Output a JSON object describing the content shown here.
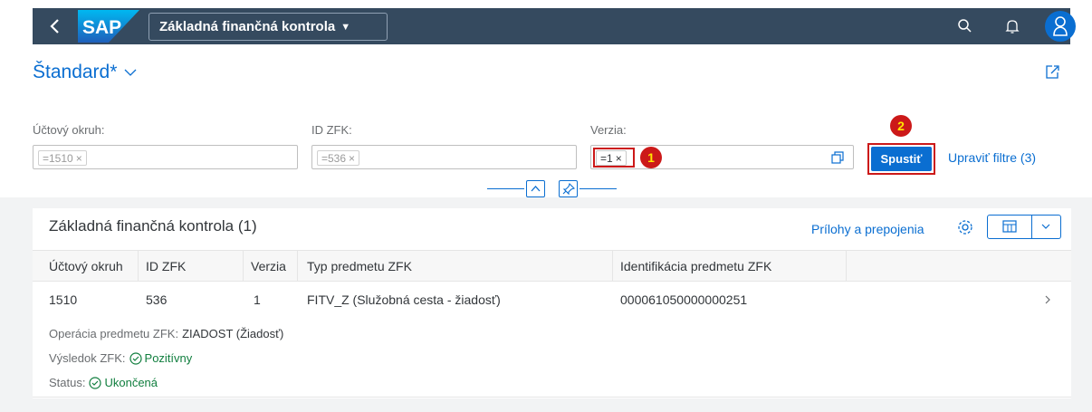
{
  "shell": {
    "logo_text": "SAP",
    "app_title": "Základná finančná kontrola",
    "avatar_icon": "person-icon"
  },
  "variant": {
    "name": "Štandard*"
  },
  "filters": {
    "fields": [
      {
        "label": "Účtový okruh:",
        "token": "=1510"
      },
      {
        "label": "ID ZFK:",
        "token": "=536"
      },
      {
        "label": "Verzia:",
        "token": "=1"
      }
    ],
    "token_remove": "×",
    "go_label": "Spustiť",
    "adapt_label": "Upraviť filtre (3)"
  },
  "annotations": {
    "badge1": "1",
    "badge2": "2",
    "color": "#cc1919"
  },
  "table": {
    "title": "Základná finančná kontrola (1)",
    "attachments_link": "Prílohy a prepojenia",
    "columns": [
      "Účtový okruh",
      "ID ZFK",
      "Verzia",
      "Typ predmetu ZFK",
      "Identifikácia predmetu ZFK"
    ],
    "rows": [
      {
        "cells": [
          "1510",
          "536",
          "1",
          "FITV_Z (Služobná cesta - žiadosť)",
          "000061050000000251"
        ],
        "operation_label": "Operácia predmetu ZFK:",
        "operation_value": "ZIADOST (Žiadosť)",
        "result_label": "Výsledok ZFK:",
        "result_value": "Pozitívny",
        "status_label": "Status:",
        "status_value": "Ukončená"
      }
    ]
  },
  "colors": {
    "shell": "#354a5f",
    "accent": "#0a6ed1",
    "positive": "#107e3e"
  }
}
